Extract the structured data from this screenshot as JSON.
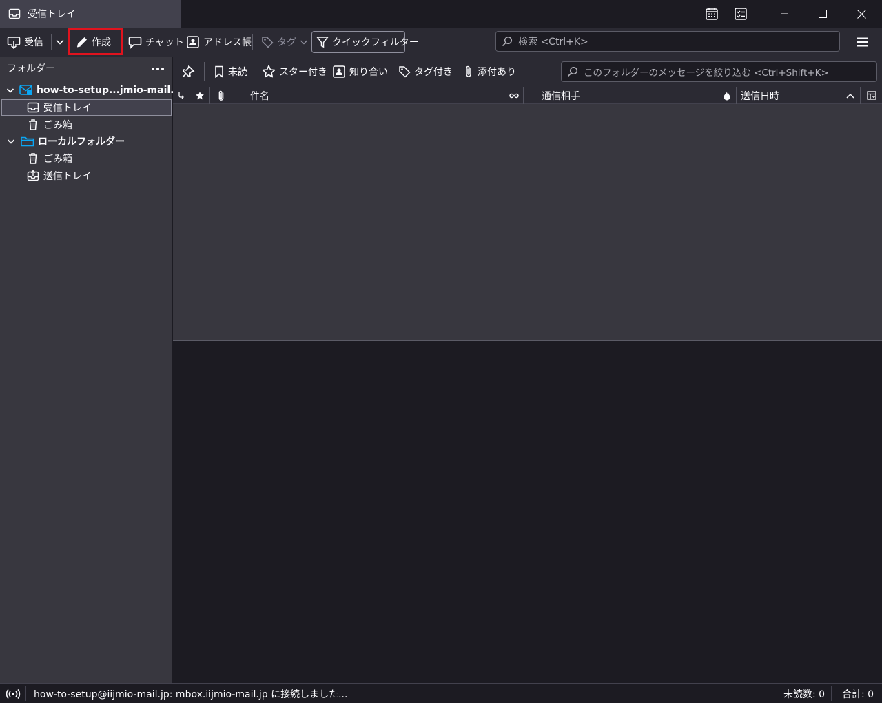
{
  "window": {
    "tab_title": "受信トレイ",
    "controls": [
      "calendar-icon",
      "tasks-icon",
      "minimize-icon",
      "maximize-icon",
      "close-icon"
    ]
  },
  "toolbar": {
    "get_messages": "受信",
    "write": "作成",
    "chat": "チャット",
    "address_book": "アドレス帳",
    "tag": "タグ",
    "quick_filter": "クイックフィルター",
    "search_placeholder": "検索 <Ctrl+K>"
  },
  "folder_pane": {
    "header": "フォルダー",
    "account": {
      "name": "how-to-setup...jmio-mail.jp",
      "folders": [
        {
          "name": "受信トレイ",
          "icon": "inbox-icon",
          "selected": true
        },
        {
          "name": "ごみ箱",
          "icon": "trash-icon",
          "selected": false
        }
      ]
    },
    "local": {
      "name": "ローカルフォルダー",
      "folders": [
        {
          "name": "ごみ箱",
          "icon": "trash-icon"
        },
        {
          "name": "送信トレイ",
          "icon": "outbox-icon"
        }
      ]
    }
  },
  "quick_filter_bar": {
    "unread": "未読",
    "starred": "スター付き",
    "contact": "知り合い",
    "tags": "タグ付き",
    "attachment": "添付あり",
    "filter_placeholder": "このフォルダーのメッセージを絞り込む <Ctrl+Shift+K>"
  },
  "columns": {
    "subject": "件名",
    "correspondents": "通信相手",
    "date": "送信日時"
  },
  "status": {
    "message": "how-to-setup@iijmio-mail.jp: mbox.iijmio-mail.jp に接続しました...",
    "unread": "未読数: 0",
    "total": "合計: 0"
  },
  "colors": {
    "highlight": "#e0131e",
    "folder_blue": "#0aa7f5"
  }
}
